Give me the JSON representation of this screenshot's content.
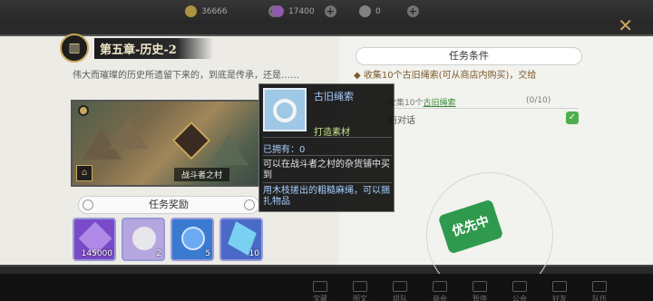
{
  "currencies": [
    {
      "icon": "gold-coin-icon",
      "value": "36666",
      "color": "#d8b54a"
    },
    {
      "icon": "purple-gem-icon",
      "value": "17400",
      "color": "#b46ad8"
    },
    {
      "icon": "silver-token-icon",
      "value": "0",
      "color": "#a0a0a0"
    }
  ],
  "chapter": {
    "title": "第五章-历史-2",
    "description": "伟大而璀璨的历史所遗留下来的，到底是传承，还是……",
    "map_label": "战斗者之村"
  },
  "rewards": {
    "header": "任务奖励",
    "items": [
      {
        "icon": "exp-crystal-icon",
        "quantity": "145000",
        "color": "#8a5ad8"
      },
      {
        "icon": "silver-coin-icon",
        "quantity": "2",
        "color": "#c4b8e8"
      },
      {
        "icon": "blue-badge-icon",
        "quantity": "5",
        "color": "#4a8ad8"
      },
      {
        "icon": "blue-crystal-icon",
        "quantity": "10",
        "color": "#5a8ad8"
      }
    ]
  },
  "conditions": {
    "header": "任务条件",
    "main_text": "收集10个古旧绳索(可从商店内购买)，交给",
    "sub1_prefix": "收集10个",
    "sub1_link": "古旧绳索",
    "sub1_progress": "(0/10)",
    "sub2": "商对话",
    "status_badge": "优先中",
    "badge_color": "#2f9a4d"
  },
  "tooltip": {
    "item_name": "古旧绳索",
    "item_type": "打造素材",
    "owned": "已拥有：0",
    "obtain": "可以在战斗者之村的杂货铺中买到",
    "description": "用木枝搓出的粗糙麻绳，可以捆扎物品"
  },
  "nav": [
    "宝藏",
    "图文",
    "组队",
    "商会",
    "暂停",
    "公会",
    "好友",
    "队伍"
  ]
}
